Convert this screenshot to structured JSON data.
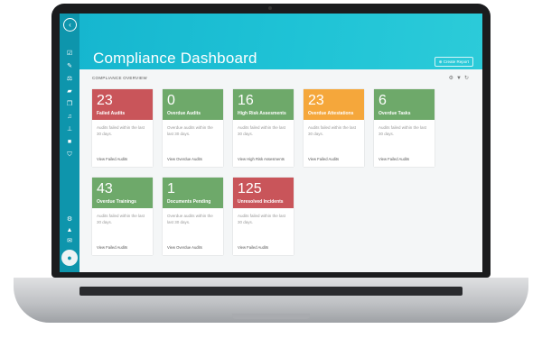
{
  "header": {
    "title": "Compliance Dashboard",
    "create_report": "Create Report"
  },
  "section_label": "COMPLIANCE OVERVIEW",
  "sidebar": {
    "icons": [
      "toggle-icon",
      "checklist-icon",
      "edit-icon",
      "balance-icon",
      "folder-icon",
      "documents-icon",
      "bell-icon",
      "org-chart-icon",
      "briefcase-icon",
      "shield-icon",
      "settings-icon",
      "alert-icon",
      "mail-icon",
      "user-icon"
    ]
  },
  "colors": {
    "red": "#c9555a",
    "green": "#6ea96a",
    "orange": "#f5a73b",
    "brand": "#16b6cf"
  },
  "cards": [
    {
      "value": "23",
      "label": "Failed Audits",
      "color": "red",
      "desc": "Audits failed within the last 30 days.",
      "link": "View Failed Audits"
    },
    {
      "value": "0",
      "label": "Overdue Audits",
      "color": "green",
      "desc": "Overdue audits within the last 30 days.",
      "link": "View Overdue Audits"
    },
    {
      "value": "16",
      "label": "High Risk Assesments",
      "color": "green",
      "desc": "Audits failed within the last 30 days.",
      "link": "View High Risk Assesments"
    },
    {
      "value": "23",
      "label": "Overdue Attestations",
      "color": "orange",
      "desc": "Audits failed within the last 30 days.",
      "link": "View Failed Audits"
    },
    {
      "value": "6",
      "label": "Overdue Tasks",
      "color": "green",
      "desc": "Audits failed within the last 30 days.",
      "link": "View Failed Audits"
    },
    {
      "value": "43",
      "label": "Overdue Trainings",
      "color": "green",
      "desc": "Audits failed within the last 30 days.",
      "link": "View Failed Audits"
    },
    {
      "value": "1",
      "label": "Documents Pending",
      "color": "green",
      "desc": "Overdue audits within the last 30 days.",
      "link": "View Overdue Audits"
    },
    {
      "value": "125",
      "label": "Unresolved Incidents",
      "color": "red",
      "desc": "Audits failed within the last 30 days.",
      "link": "View Failed Audits"
    }
  ]
}
